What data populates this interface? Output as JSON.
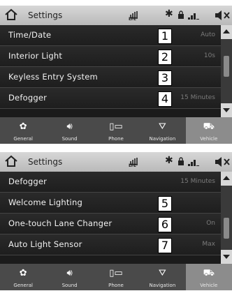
{
  "colors": {
    "status_bar": "#c8c8c8",
    "list_bg": "#1e1e1e",
    "row_text": "#f2f2f2",
    "value_text": "#7c7c7c",
    "tab_bar": "#4a4a4a",
    "tab_selected": "#8c8c8c"
  },
  "screens": [
    {
      "status": {
        "title": "Settings",
        "lte": "LTE"
      },
      "rows": [
        {
          "label": "Time/Date",
          "value": "Auto",
          "callout": "1"
        },
        {
          "label": "Interior Light",
          "value": "10s",
          "callout": "2"
        },
        {
          "label": "Keyless Entry System",
          "value": "",
          "callout": "3"
        },
        {
          "label": "Defogger",
          "value": "15 Minutes",
          "callout": "4"
        }
      ],
      "tabs": [
        {
          "label": "General",
          "icon": "gear-icon",
          "selected": false
        },
        {
          "label": "Sound",
          "icon": "speaker-icon",
          "selected": false
        },
        {
          "label": "Phone",
          "icon": "phone-icon",
          "selected": false
        },
        {
          "label": "Navigation",
          "icon": "navigation-icon",
          "selected": false
        },
        {
          "label": "Vehicle",
          "icon": "car-icon",
          "selected": true
        }
      ]
    },
    {
      "status": {
        "title": "Settings",
        "lte": "LTE"
      },
      "rows": [
        {
          "label": "Defogger",
          "value": "15 Minutes",
          "callout": ""
        },
        {
          "label": "Welcome Lighting",
          "value": "",
          "callout": "5"
        },
        {
          "label": "One-touch Lane Changer",
          "value": "On",
          "callout": "6"
        },
        {
          "label": "Auto Light Sensor",
          "value": "Max",
          "callout": "7"
        }
      ],
      "tabs": [
        {
          "label": "General",
          "icon": "gear-icon",
          "selected": false
        },
        {
          "label": "Sound",
          "icon": "speaker-icon",
          "selected": false
        },
        {
          "label": "Phone",
          "icon": "phone-icon",
          "selected": false
        },
        {
          "label": "Navigation",
          "icon": "navigation-icon",
          "selected": false
        },
        {
          "label": "Vehicle",
          "icon": "car-icon",
          "selected": true
        }
      ]
    }
  ]
}
